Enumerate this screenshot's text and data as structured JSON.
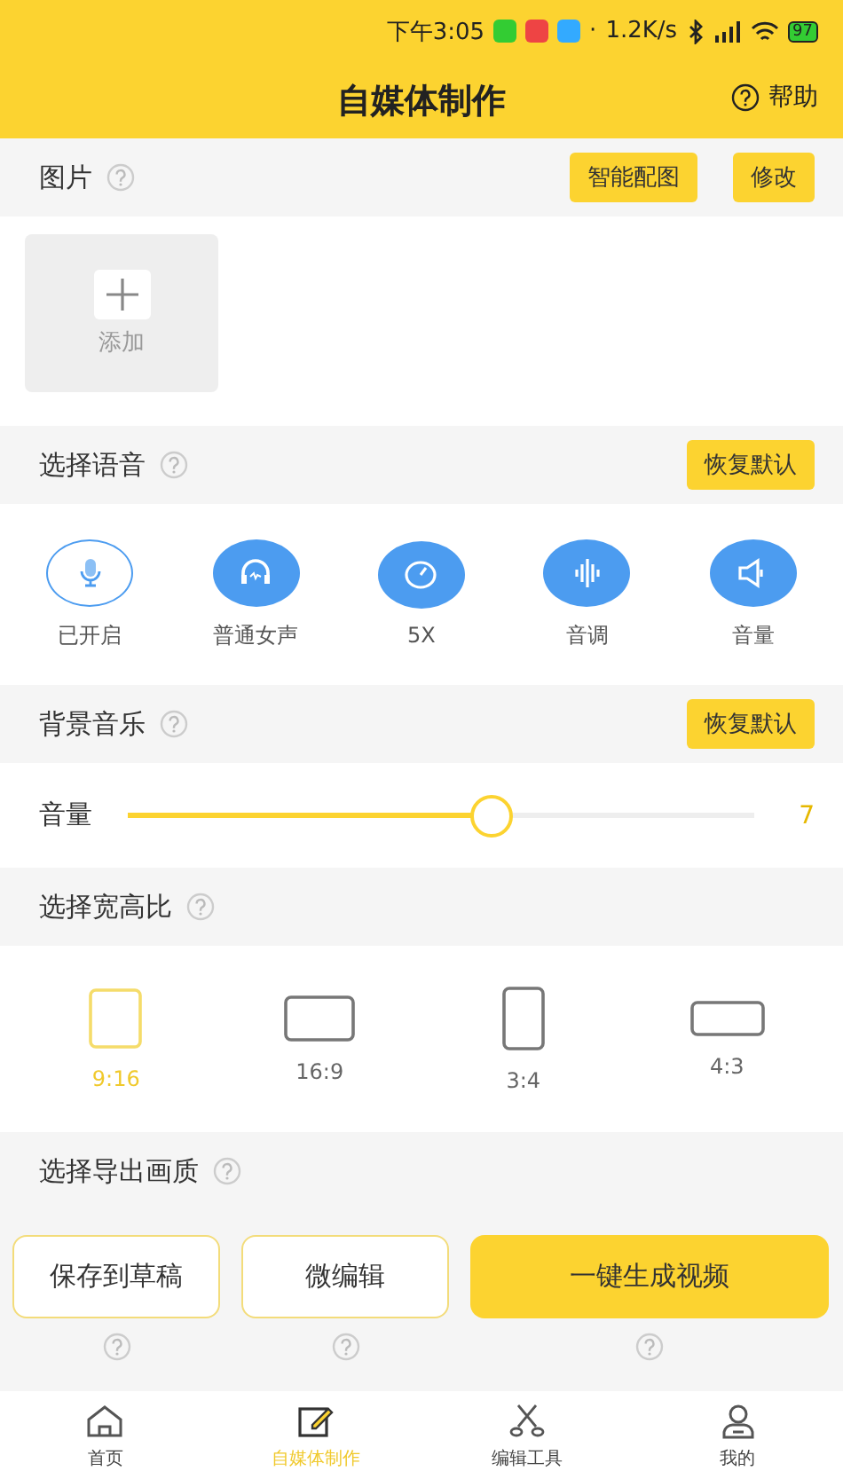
{
  "status_bar": {
    "time": "下午3:05",
    "separator": "·",
    "speed": "1.2K/s",
    "battery": "97"
  },
  "header": {
    "title": "自媒体制作",
    "help": "帮助"
  },
  "picture_section": {
    "title": "图片",
    "buttons": [
      {
        "label": "智能配图"
      },
      {
        "label": "修改"
      }
    ],
    "add_label": "添加"
  },
  "voice_section": {
    "title": "选择语音",
    "reset": "恢复默认",
    "items": [
      {
        "label": "已开启",
        "kind": "toggle"
      },
      {
        "label": "普通女声",
        "kind": "setting"
      },
      {
        "label": "5X",
        "kind": "setting"
      },
      {
        "label": "音调",
        "kind": "setting"
      },
      {
        "label": "音量",
        "kind": "setting"
      }
    ]
  },
  "music_section": {
    "title": "背景音乐",
    "reset": "恢复默认",
    "volume": {
      "label": "音量",
      "level": 0.58,
      "reading": "7"
    }
  },
  "ratio_section": {
    "title": "选择宽高比",
    "options": [
      {
        "label": "9:16",
        "selected": true
      },
      {
        "label": "16:9",
        "selected": false
      },
      {
        "label": "3:4",
        "selected": false
      },
      {
        "label": "4:3",
        "selected": false
      }
    ]
  },
  "quality_section": {
    "title": "选择导出画质"
  },
  "actions": [
    {
      "label": "保存到草稿",
      "kind": "outline"
    },
    {
      "label": "微编辑",
      "kind": "outline"
    },
    {
      "label": "一键生成视频",
      "kind": "primary"
    }
  ],
  "tabs": [
    {
      "label": "首页",
      "selected": false
    },
    {
      "label": "自媒体制作",
      "selected": true
    },
    {
      "label": "编辑工具",
      "selected": false
    },
    {
      "label": "我的",
      "selected": false
    }
  ]
}
